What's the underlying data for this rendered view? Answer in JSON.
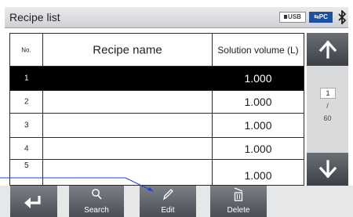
{
  "header": {
    "title": "Recipe list",
    "usb_label": "USB",
    "pc_label": "PC",
    "bluetooth_icon": "bluetooth-icon"
  },
  "table": {
    "columns": [
      "No.",
      "Recipe name",
      "Solution volume (L)"
    ],
    "rows": [
      {
        "no": "1",
        "name": "",
        "volume": "1.000",
        "selected": true
      },
      {
        "no": "2",
        "name": "",
        "volume": "1.000",
        "selected": false
      },
      {
        "no": "3",
        "name": "",
        "volume": "1.000",
        "selected": false
      },
      {
        "no": "4",
        "name": "",
        "volume": "1.000",
        "selected": false
      },
      {
        "no": "5",
        "name": "",
        "volume": "1.000",
        "selected": false
      }
    ]
  },
  "pager": {
    "current": "1",
    "separator": "/",
    "total": "60",
    "up_icon": "arrow-up-icon",
    "down_icon": "arrow-down-icon"
  },
  "footer": {
    "back_icon": "return-icon",
    "search_label": "Search",
    "edit_label": "Edit",
    "delete_label": "Delete"
  },
  "colors": {
    "selected_row": "#000000",
    "pc_badge": "#1d4fa3",
    "callout_line": "#1d3fd6"
  }
}
